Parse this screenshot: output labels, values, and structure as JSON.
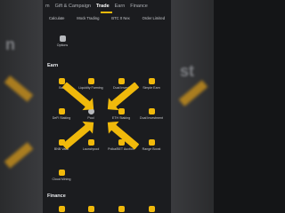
{
  "top_nav": {
    "tabs": [
      "m",
      "Gift & Campaign",
      "Trade",
      "Earn",
      "Finance"
    ],
    "active_index": 2
  },
  "trade_row": [
    "Calculate",
    "Mock Trading",
    "BTC 0 Nex",
    "Order Limited"
  ],
  "options_label": "Options",
  "earn": {
    "title": "Earn",
    "items": [
      "Bar",
      "Liquidity Farming",
      "Dual Invest",
      "Simple Earn",
      "DeFi Staking",
      "Pool",
      "ETH Staking",
      "Dual Investment",
      "BNB Vault",
      "Launchpool",
      "Polka/BET Auction",
      "Range Boost",
      "Cloud Mining"
    ]
  },
  "finance_title": "Finance",
  "side_ghost": {
    "left": "n",
    "right": "st"
  }
}
